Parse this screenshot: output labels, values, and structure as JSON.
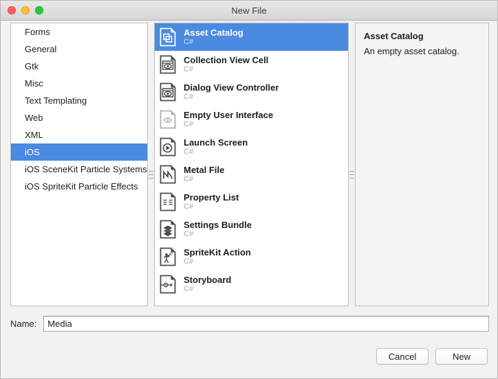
{
  "window": {
    "title": "New File",
    "traffic_lights": [
      {
        "name": "close-button",
        "color": "#ff5f57"
      },
      {
        "name": "minimize-button",
        "color": "#ffbd2e"
      },
      {
        "name": "maximize-button",
        "color": "#28c840"
      }
    ]
  },
  "categories": {
    "selected": "iOS",
    "items": [
      {
        "label": "Forms",
        "selected": false
      },
      {
        "label": "General",
        "selected": false
      },
      {
        "label": "Gtk",
        "selected": false
      },
      {
        "label": "Misc",
        "selected": false
      },
      {
        "label": "Text Templating",
        "selected": false
      },
      {
        "label": "Web",
        "selected": false
      },
      {
        "label": "XML",
        "selected": false
      },
      {
        "label": "iOS",
        "selected": true
      },
      {
        "label": "iOS SceneKit Particle Systems",
        "selected": false
      },
      {
        "label": "iOS SpriteKit Particle Effects",
        "selected": false
      }
    ]
  },
  "templates": {
    "selected": "Asset Catalog",
    "items": [
      {
        "name": "Asset Catalog",
        "lang": "C#",
        "icon": "asset-catalog-icon",
        "selected": true
      },
      {
        "name": "Collection View Cell",
        "lang": "C#",
        "icon": "collection-view-cell-icon",
        "selected": false
      },
      {
        "name": "Dialog View Controller",
        "lang": "C#",
        "icon": "dialog-view-controller-icon",
        "selected": false
      },
      {
        "name": "Empty User Interface",
        "lang": "C#",
        "icon": "empty-user-interface-icon",
        "selected": false
      },
      {
        "name": "Launch Screen",
        "lang": "C#",
        "icon": "launch-screen-icon",
        "selected": false
      },
      {
        "name": "Metal File",
        "lang": "C#",
        "icon": "metal-file-icon",
        "selected": false
      },
      {
        "name": "Property List",
        "lang": "C#",
        "icon": "property-list-icon",
        "selected": false
      },
      {
        "name": "Settings Bundle",
        "lang": "C#",
        "icon": "settings-bundle-icon",
        "selected": false
      },
      {
        "name": "SpriteKit Action",
        "lang": "C#",
        "icon": "spritekit-action-icon",
        "selected": false
      },
      {
        "name": "Storyboard",
        "lang": "C#",
        "icon": "storyboard-icon",
        "selected": false
      }
    ]
  },
  "description": {
    "title": "Asset Catalog",
    "body": "An empty asset catalog."
  },
  "name_field": {
    "label": "Name:",
    "value": "Media",
    "placeholder": ""
  },
  "footer": {
    "cancel_label": "Cancel",
    "new_label": "New"
  },
  "colors": {
    "selection_blue": "#4a8ae0",
    "window_background": "#f2f2f2",
    "pane_border": "#bdbdbd",
    "text_primary": "#1d1d1d",
    "text_muted": "#a8a8a8"
  }
}
